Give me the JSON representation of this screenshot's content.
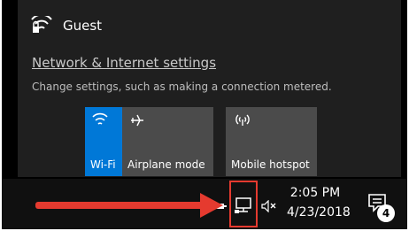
{
  "flyout": {
    "user": {
      "icon": "wifi-lock-icon",
      "name": "Guest"
    },
    "network_link": "Network & Internet settings",
    "network_description": "Change settings, such as making a connection metered.",
    "tiles": [
      {
        "icon": "wifi-icon",
        "label": "Wi-Fi",
        "active": true
      },
      {
        "icon": "airplane-icon",
        "label": "Airplane mode",
        "active": false
      },
      {
        "icon": "hotspot-icon",
        "label": "Mobile hotspot",
        "active": false
      }
    ]
  },
  "taskbar": {
    "time": "2:05 PM",
    "date": "4/23/2018",
    "notification_count": "4",
    "tray_icons": [
      "pen-icon",
      "network-icon",
      "volume-muted-icon"
    ]
  },
  "colors": {
    "accent": "#0078d7",
    "annotation": "#e53a2f",
    "tile": "#4b4b4b",
    "flyout_bg": "#1f1f1f"
  }
}
